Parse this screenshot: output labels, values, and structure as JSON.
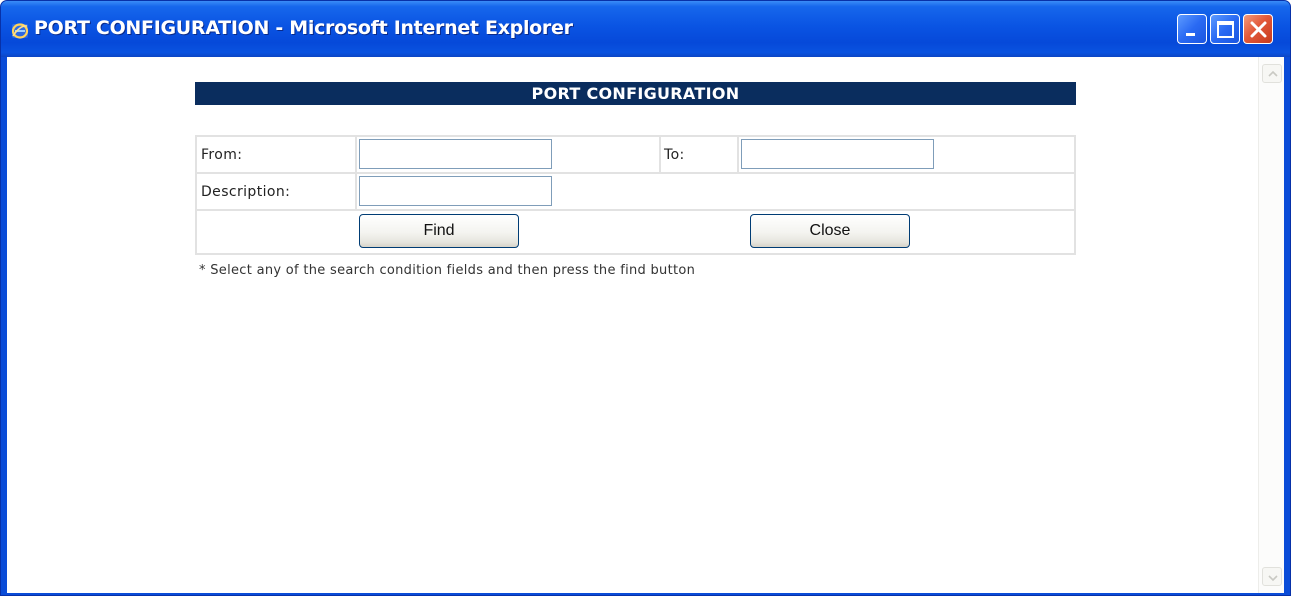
{
  "window": {
    "title": "PORT CONFIGURATION - Microsoft Internet Explorer"
  },
  "page": {
    "heading": "PORT CONFIGURATION",
    "from_label": "From:",
    "from_value": "",
    "to_label": "To:",
    "to_value": "",
    "description_label": "Description:",
    "description_value": "",
    "find_label": "Find",
    "close_label": "Close",
    "note": "* Select any of the search condition fields and then press the find button"
  },
  "colors": {
    "header_bg": "#0a2d5e",
    "title_bar": "#0a54e3",
    "close_button": "#e2593a"
  }
}
